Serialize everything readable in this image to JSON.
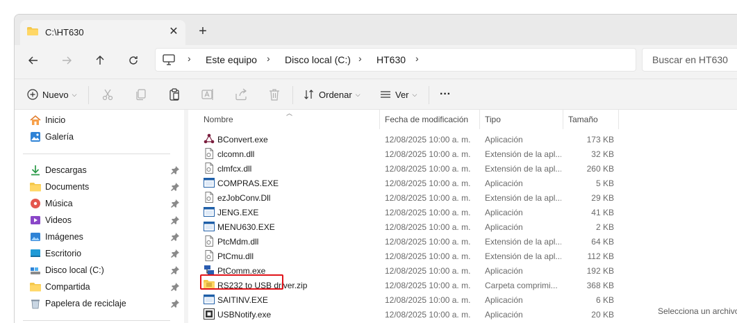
{
  "tab": {
    "title": "C:\\HT630"
  },
  "nav": {
    "breadcrumb": [
      "Este equipo",
      "Disco local (C:)",
      "HT630"
    ],
    "search_placeholder": "Buscar en HT630"
  },
  "commands": {
    "new": "Nuevo",
    "sort": "Ordenar",
    "view": "Ver",
    "more": "···"
  },
  "sidebar": {
    "top": [
      {
        "label": "Inicio",
        "icon": "home-icon"
      },
      {
        "label": "Galería",
        "icon": "gallery-icon"
      }
    ],
    "pinned": [
      {
        "label": "Descargas",
        "icon": "download-icon"
      },
      {
        "label": "Documents",
        "icon": "folder-icon"
      },
      {
        "label": "Música",
        "icon": "music-icon"
      },
      {
        "label": "Videos",
        "icon": "video-icon"
      },
      {
        "label": "Imágenes",
        "icon": "images-icon"
      },
      {
        "label": "Escritorio",
        "icon": "desktop-icon"
      },
      {
        "label": "Disco local (C:)",
        "icon": "drive-icon"
      },
      {
        "label": "Compartida",
        "icon": "folder-icon"
      },
      {
        "label": "Papelera de reciclaje",
        "icon": "recycle-bin-icon"
      }
    ]
  },
  "columns": [
    "Nombre",
    "Fecha de modificación",
    "Tipo",
    "Tamaño"
  ],
  "files": [
    {
      "name": "BConvert.exe",
      "date": "12/08/2025 10:00 a. m.",
      "type": "Aplicación",
      "size": "173 KB",
      "icon": "bconvert-icon"
    },
    {
      "name": "clcomn.dll",
      "date": "12/08/2025 10:00 a. m.",
      "type": "Extensión de la apl...",
      "size": "32 KB",
      "icon": "dll-icon"
    },
    {
      "name": "clmfcx.dll",
      "date": "12/08/2025 10:00 a. m.",
      "type": "Extensión de la apl...",
      "size": "260 KB",
      "icon": "dll-icon"
    },
    {
      "name": "COMPRAS.EXE",
      "date": "12/08/2025 10:00 a. m.",
      "type": "Aplicación",
      "size": "5 KB",
      "icon": "exe-icon"
    },
    {
      "name": "ezJobConv.Dll",
      "date": "12/08/2025 10:00 a. m.",
      "type": "Extensión de la apl...",
      "size": "29 KB",
      "icon": "dll-icon"
    },
    {
      "name": "JENG.EXE",
      "date": "12/08/2025 10:00 a. m.",
      "type": "Aplicación",
      "size": "41 KB",
      "icon": "exe-icon"
    },
    {
      "name": "MENU630.EXE",
      "date": "12/08/2025 10:00 a. m.",
      "type": "Aplicación",
      "size": "2 KB",
      "icon": "exe-icon"
    },
    {
      "name": "PtcMdm.dll",
      "date": "12/08/2025 10:00 a. m.",
      "type": "Extensión de la apl...",
      "size": "64 KB",
      "icon": "dll-icon"
    },
    {
      "name": "PtCmu.dll",
      "date": "12/08/2025 10:00 a. m.",
      "type": "Extensión de la apl...",
      "size": "112 KB",
      "icon": "dll-icon"
    },
    {
      "name": "PtComm.exe",
      "date": "12/08/2025 10:00 a. m.",
      "type": "Aplicación",
      "size": "192 KB",
      "icon": "ptcomm-icon"
    },
    {
      "name": "RS232 to USB driver.zip",
      "date": "12/08/2025 10:00 a. m.",
      "type": "Carpeta comprimi...",
      "size": "368 KB",
      "icon": "zip-folder-icon"
    },
    {
      "name": "SAITINV.EXE",
      "date": "12/08/2025 10:00 a. m.",
      "type": "Aplicación",
      "size": "6 KB",
      "icon": "exe-icon"
    },
    {
      "name": "USBNotify.exe",
      "date": "12/08/2025 10:00 a. m.",
      "type": "Aplicación",
      "size": "20 KB",
      "icon": "usbnotify-icon"
    }
  ],
  "preview_text": "Selecciona un archivo",
  "colors": {
    "highlight": "#e0131a",
    "folder": "#f4c84c",
    "accent": "#1c6fd1"
  }
}
